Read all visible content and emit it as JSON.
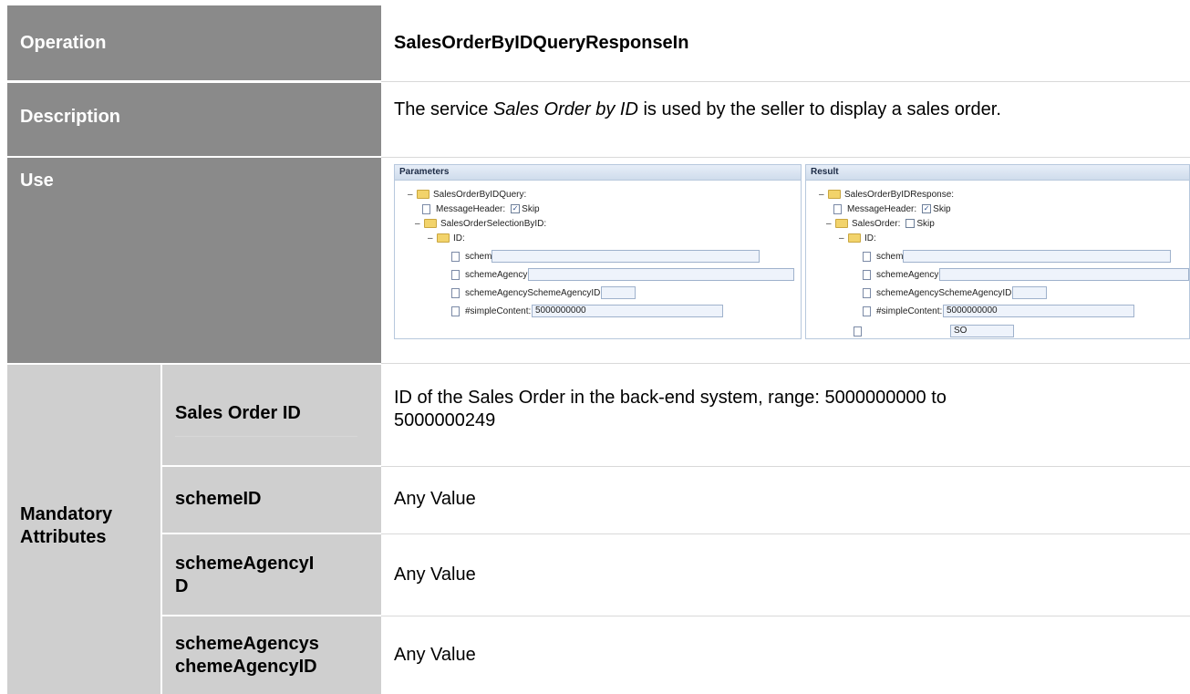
{
  "operation": {
    "label": "Operation",
    "value": "SalesOrderByIDQueryResponseIn"
  },
  "description": {
    "label": "Description",
    "text_before": "The service ",
    "text_italic": "Sales Order by ID",
    "text_after": " is used by the seller to display a sales order."
  },
  "use": {
    "label": "Use",
    "parameters_panel": {
      "title": "Parameters",
      "root": "SalesOrderByIDQuery:",
      "message_header": "MessageHeader:",
      "skip": "Skip",
      "selection": "SalesOrderSelectionByID:",
      "id": "ID:",
      "scheme_id": "schemeID:",
      "scheme_agency_id": "schemeAgencyID:",
      "scheme_agency_scheme_agency_id": "schemeAgencySchemeAgencyID:",
      "simple_content": "#simpleContent:",
      "simple_content_value": "5000000000"
    },
    "result_panel": {
      "title": "Result",
      "root": "SalesOrderByIDResponse:",
      "message_header": "MessageHeader:",
      "skip": "Skip",
      "sales_order": "SalesOrder:",
      "sales_order_skip": "Skip",
      "id": "ID:",
      "scheme_id": "schemeID:",
      "scheme_agency_id": "schemeAgencyID:",
      "scheme_agency_scheme_agency_id": "schemeAgencySchemeAgencyID:",
      "simple_content": "#simpleContent:",
      "simple_content_value": "5000000000",
      "processing_type_value": "SO"
    }
  },
  "mandatory": {
    "label_line1": "Mandatory",
    "label_line2": "Attributes",
    "rows": [
      {
        "name_line1": "Sales Order ID",
        "name_line2": "",
        "value_line1": "ID of the Sales Order in the back-end system, range: 5000000000 to",
        "value_line2": "5000000249"
      },
      {
        "name_line1": "schemeID",
        "name_line2": "",
        "value_line1": "Any Value",
        "value_line2": ""
      },
      {
        "name_line1": "schemeAgencyI",
        "name_line2": "D",
        "value_line1": "Any Value",
        "value_line2": ""
      },
      {
        "name_line1": "schemeAgencys",
        "name_line2": "chemeAgencyID",
        "value_line1": "Any Value",
        "value_line2": ""
      }
    ]
  },
  "colors": {
    "header_bg": "#8a8a8a",
    "subheader_bg": "#cfcfcf",
    "panel_header": "#cfdcec",
    "input_bg": "#eef3fb"
  }
}
